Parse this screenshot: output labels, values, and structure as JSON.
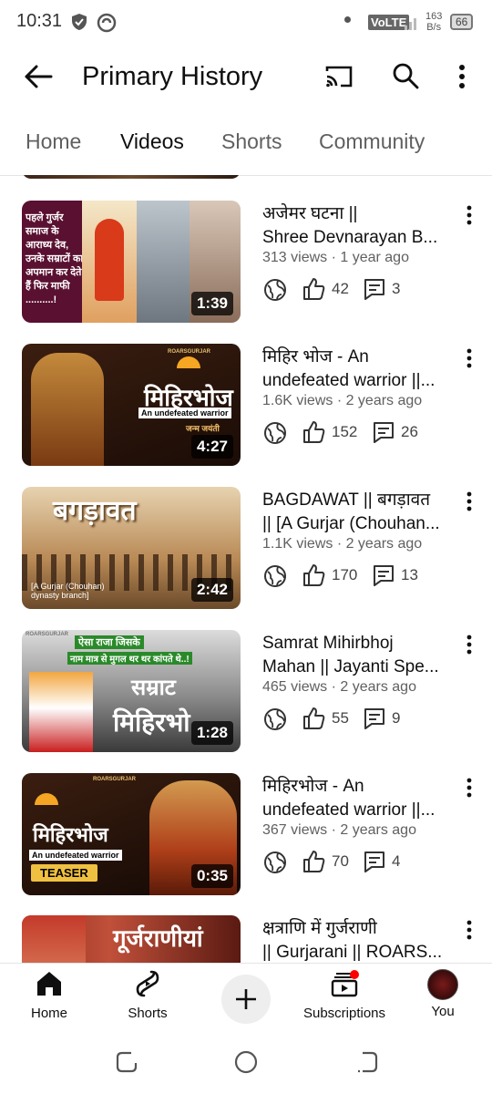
{
  "status": {
    "time": "10:31",
    "net": "VoLTE",
    "speed": "163",
    "speed_unit": "B/s",
    "battery": "66"
  },
  "header": {
    "title": "Primary History"
  },
  "tabs": [
    {
      "label": "Home"
    },
    {
      "label": "Videos"
    },
    {
      "label": "Shorts"
    },
    {
      "label": "Community"
    }
  ],
  "videos": [
    {
      "title1": "अजेमर घटना ||",
      "title2": "Shree Devnarayan B...",
      "meta": "313 views · 1 year ago",
      "likes": "42",
      "comments": "3",
      "duration": "1:39",
      "thumb_text": "पहले गुर्जर समाज के आराध्य देव, उनके सम्राटों का अपमान कर देते हैं फिर माफी ..........!"
    },
    {
      "title1": "मिहिर भोज - An",
      "title2": "undefeated warrior ||...",
      "meta": "1.6K views · 2 years ago",
      "likes": "152",
      "comments": "26",
      "duration": "4:27",
      "thumb_text": "मिहिरभोज",
      "thumb_sub": "An undefeated warrior",
      "thumb_small": "जन्म जयंती",
      "brand": "ROARSGURJAR"
    },
    {
      "title1": "BAGDAWAT || बगड़ावत",
      "title2": "|| [A Gurjar (Chouhan...",
      "meta": "1.1K views · 2 years ago",
      "likes": "170",
      "comments": "13",
      "duration": "2:42",
      "thumb_text": "बगड़ावत",
      "thumb_sub": "[A Gurjar (Chouhan) dynasty branch]"
    },
    {
      "title1": "Samrat Mihirbhoj",
      "title2": "Mahan || Jayanti Spe...",
      "meta": "465 views · 2 years ago",
      "likes": "55",
      "comments": "9",
      "duration": "1:28",
      "thumb_text": "सम्राट",
      "thumb_sub": "मिहिरभो",
      "thumb_top": "ऐसा राजा जिसके",
      "thumb_top2": "नाम मात्र से मुगल थर थर कांपते थे..!",
      "brand": "ROARSGURJAR"
    },
    {
      "title1": "मिहिरभोज - An",
      "title2": "undefeated warrior ||...",
      "meta": "367 views · 2 years ago",
      "likes": "70",
      "comments": "4",
      "duration": "0:35",
      "thumb_text": "मिहिरभोज",
      "thumb_sub": "An undefeated warrior",
      "thumb_small": "TEASER",
      "brand": "ROARSGURJAR"
    },
    {
      "title1": "क्षत्राणि में गुर्जराणी",
      "title2": "|| Gurjarani  || ROARS...",
      "meta": "",
      "likes": "",
      "comments": "",
      "duration": "",
      "thumb_text": "गूर्जराणीयां"
    }
  ],
  "bottom_nav": [
    {
      "label": "Home"
    },
    {
      "label": "Shorts"
    },
    {
      "label": ""
    },
    {
      "label": "Subscriptions"
    },
    {
      "label": "You"
    }
  ],
  "colors": {
    "accent": "#ff0000",
    "text": "#0f0f0f",
    "secondary": "#606060"
  }
}
